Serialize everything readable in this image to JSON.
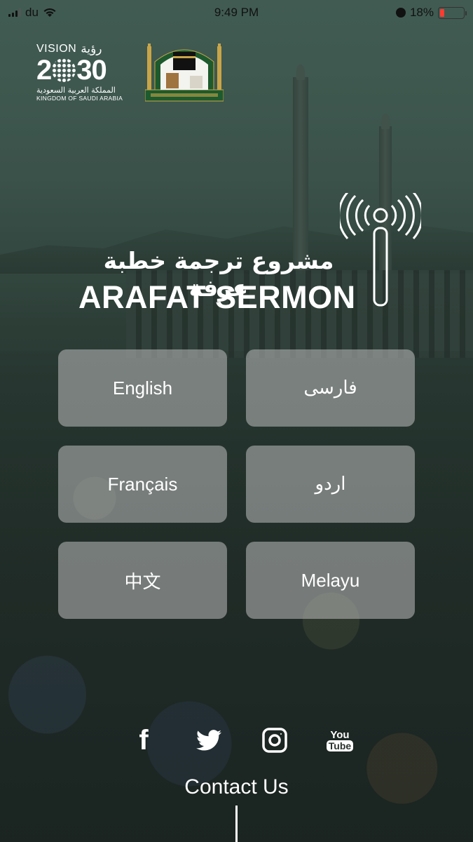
{
  "status_bar": {
    "carrier": "du",
    "time": "9:49 PM",
    "battery_percent": "18%",
    "battery_level": 0.18,
    "icons": [
      "signal-icon",
      "wifi-icon",
      "alarm-icon",
      "battery-icon"
    ]
  },
  "logos": {
    "vision": {
      "label_en": "VISION",
      "label_ar": "رؤية",
      "year": "2030",
      "kingdom_ar": "المملكة العربية السعودية",
      "kingdom_en": "KINGDOM OF SAUDI ARABIA"
    },
    "haramain": {
      "name": "haramain-presidency-logo"
    }
  },
  "title": {
    "arabic": "مشروع ترجمة خطبة عرفة",
    "english": "ARAFAT SERMON"
  },
  "languages": [
    {
      "label": "English",
      "rtl": false
    },
    {
      "label": "فارسی",
      "rtl": true
    },
    {
      "label": "Français",
      "rtl": false
    },
    {
      "label": "اردو",
      "rtl": true
    },
    {
      "label": "中文",
      "rtl": false
    },
    {
      "label": "Melayu",
      "rtl": false
    }
  ],
  "social": [
    {
      "name": "facebook",
      "glyph": "f"
    },
    {
      "name": "twitter"
    },
    {
      "name": "instagram"
    },
    {
      "name": "youtube",
      "line1": "You",
      "line2": "Tube"
    }
  ],
  "footer": {
    "contact_label": "Contact Us"
  },
  "colors": {
    "battery_low": "#ff3b30",
    "button_bg": "rgba(190,190,190,0.55)",
    "text": "#ffffff",
    "logo_green": "#1d5a2e",
    "logo_gold": "#c9a548"
  }
}
